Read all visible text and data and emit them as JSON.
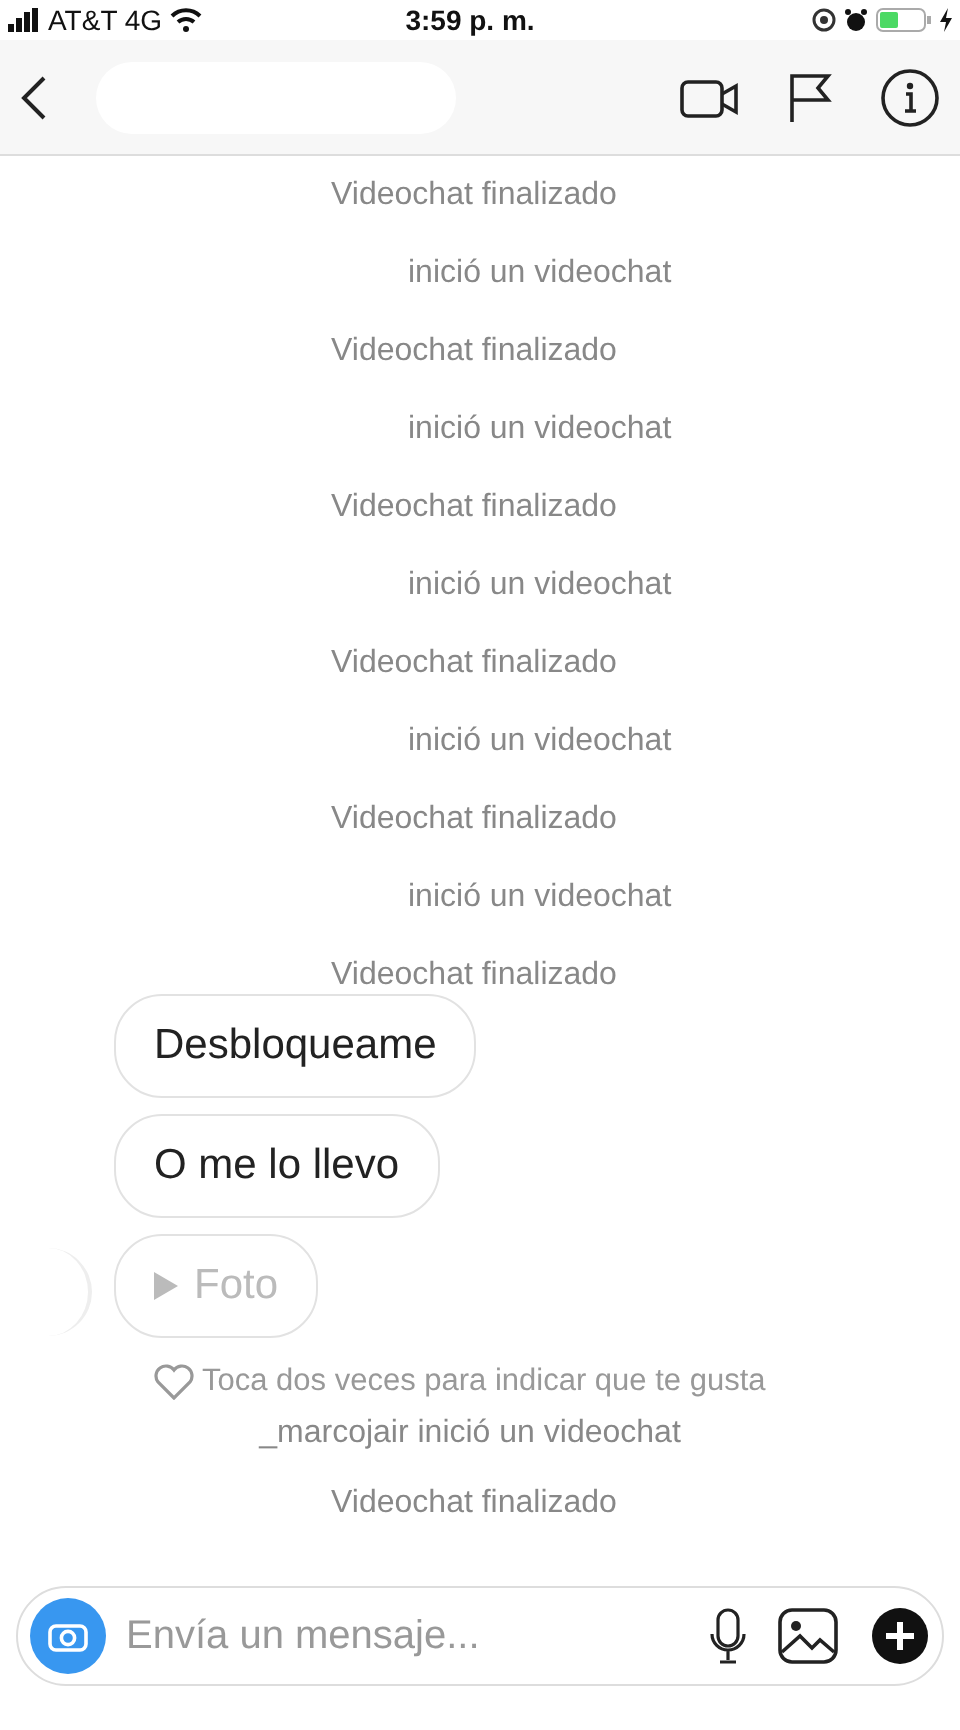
{
  "status_bar": {
    "carrier": "AT&T 4G",
    "time": "3:59 p. m."
  },
  "events": [
    {
      "kind": "ended",
      "text": "Videochat finalizado"
    },
    {
      "kind": "started",
      "text": "inició un videochat"
    },
    {
      "kind": "ended",
      "text": "Videochat finalizado"
    },
    {
      "kind": "started",
      "text": "inició un videochat"
    },
    {
      "kind": "ended",
      "text": "Videochat finalizado"
    },
    {
      "kind": "started",
      "text": "inició un videochat"
    },
    {
      "kind": "ended",
      "text": "Videochat finalizado"
    },
    {
      "kind": "started",
      "text": "inició un videochat"
    },
    {
      "kind": "ended",
      "text": "Videochat finalizado"
    },
    {
      "kind": "started",
      "text": "inició un videochat"
    },
    {
      "kind": "ended",
      "text": "Videochat finalizado"
    }
  ],
  "messages": [
    {
      "kind": "text",
      "text": "Desbloqueame"
    },
    {
      "kind": "text",
      "text": "O me lo llevo"
    },
    {
      "kind": "media",
      "text": "Foto"
    }
  ],
  "like_hint": "Toca dos veces para indicar que te gusta",
  "after_events": [
    {
      "kind": "named",
      "text": "_marcojair inició un videochat"
    },
    {
      "kind": "ended",
      "text": "Videochat finalizado"
    }
  ],
  "composer": {
    "placeholder": "Envía un mensaje..."
  }
}
